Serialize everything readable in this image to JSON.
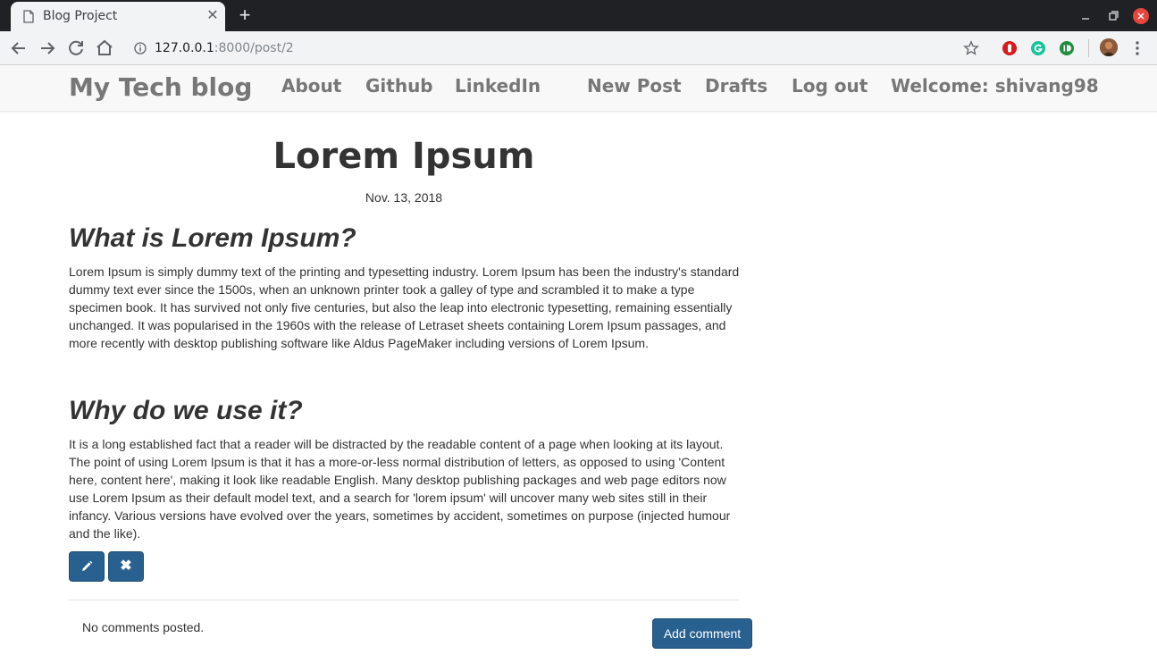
{
  "browser": {
    "tab": {
      "title": "Blog Project",
      "close_glyph": "✕",
      "icon": "page-icon"
    },
    "new_tab_glyph": "+",
    "url": {
      "host": "127.0.0.1",
      "path": ":8000/post/2"
    },
    "colors": {
      "titlebar": "#202124",
      "toolbar": "#f1f3f4",
      "close_button": "#e8453c"
    }
  },
  "site": {
    "brand": "My Tech blog",
    "nav_left": [
      "About",
      "Github",
      "LinkedIn"
    ],
    "nav_right": [
      "New Post",
      "Drafts",
      "Log out",
      "Welcome: shivang98"
    ]
  },
  "post": {
    "title": "Lorem Ipsum",
    "date": "Nov. 13, 2018",
    "sections": [
      {
        "heading": "What is Lorem Ipsum?",
        "body": "Lorem Ipsum is simply dummy text of the printing and typesetting industry. Lorem Ipsum has been the industry's standard dummy text ever since the 1500s, when an unknown printer took a galley of type and scrambled it to make a type specimen book. It has survived not only five centuries, but also the leap into electronic typesetting, remaining essentially unchanged. It was popularised in the 1960s with the release of Letraset sheets containing Lorem Ipsum passages, and more recently with desktop publishing software like Aldus PageMaker including versions of Lorem Ipsum."
      },
      {
        "heading": "Why do we use it?",
        "body": "It is a long established fact that a reader will be distracted by the readable content of a page when looking at its layout. The point of using Lorem Ipsum is that it has a more-or-less normal distribution of letters, as opposed to using 'Content here, content here', making it look like readable English. Many desktop publishing packages and web page editors now use Lorem Ipsum as their default model text, and a search for 'lorem ipsum' will uncover many web sites still in their infancy. Various versions have evolved over the years, sometimes by accident, sometimes on purpose (injected humour and the like)."
      }
    ],
    "actions": {
      "edit_icon": "pencil-icon",
      "delete_icon": "remove-icon",
      "delete_glyph": "✖"
    },
    "accent_color": "#286090"
  },
  "comments": {
    "empty_text": "No comments posted.",
    "add_label": "Add comment"
  }
}
